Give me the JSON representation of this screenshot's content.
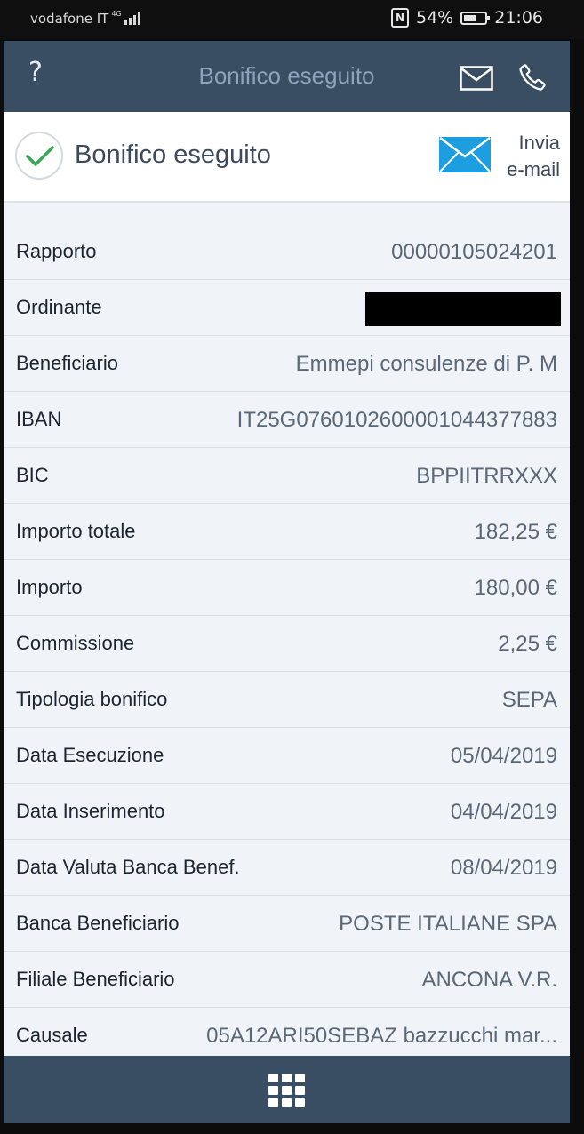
{
  "status_bar": {
    "carrier": "vodafone IT",
    "network": "4G",
    "battery": "54%",
    "time": "21:06"
  },
  "top_bar": {
    "help": "?",
    "title": "Bonifico eseguito"
  },
  "header": {
    "title": "Bonifico eseguito",
    "email_line1": "Invia",
    "email_line2": "e-mail"
  },
  "details": [
    {
      "label": "Rapporto",
      "value": "00000105024201"
    },
    {
      "label": "Ordinante",
      "value": ""
    },
    {
      "label": "Beneficiario",
      "value": "Emmepi consulenze di P. M"
    },
    {
      "label": "IBAN",
      "value": "IT25G0760102600001044377883"
    },
    {
      "label": "BIC",
      "value": "BPPIITRRXXX"
    },
    {
      "label": "Importo totale",
      "value": "182,25 €"
    },
    {
      "label": "Importo",
      "value": "180,00 €"
    },
    {
      "label": "Commissione",
      "value": "2,25 €"
    },
    {
      "label": "Tipologia bonifico",
      "value": "SEPA"
    },
    {
      "label": "Data Esecuzione",
      "value": "05/04/2019"
    },
    {
      "label": "Data Inserimento",
      "value": "04/04/2019"
    },
    {
      "label": "Data Valuta Banca Benef.",
      "value": "08/04/2019"
    },
    {
      "label": "Banca Beneficiario",
      "value": "POSTE ITALIANE SPA"
    },
    {
      "label": "Filiale Beneficiario",
      "value": "ANCONA V.R."
    },
    {
      "label": "Causale",
      "value": "05A12ARI50SEBAZ bazzucchi mar..."
    }
  ],
  "colors": {
    "top_bar": "#3a4e63",
    "accent_blue": "#1d9ee0",
    "check_green": "#3aa657"
  }
}
